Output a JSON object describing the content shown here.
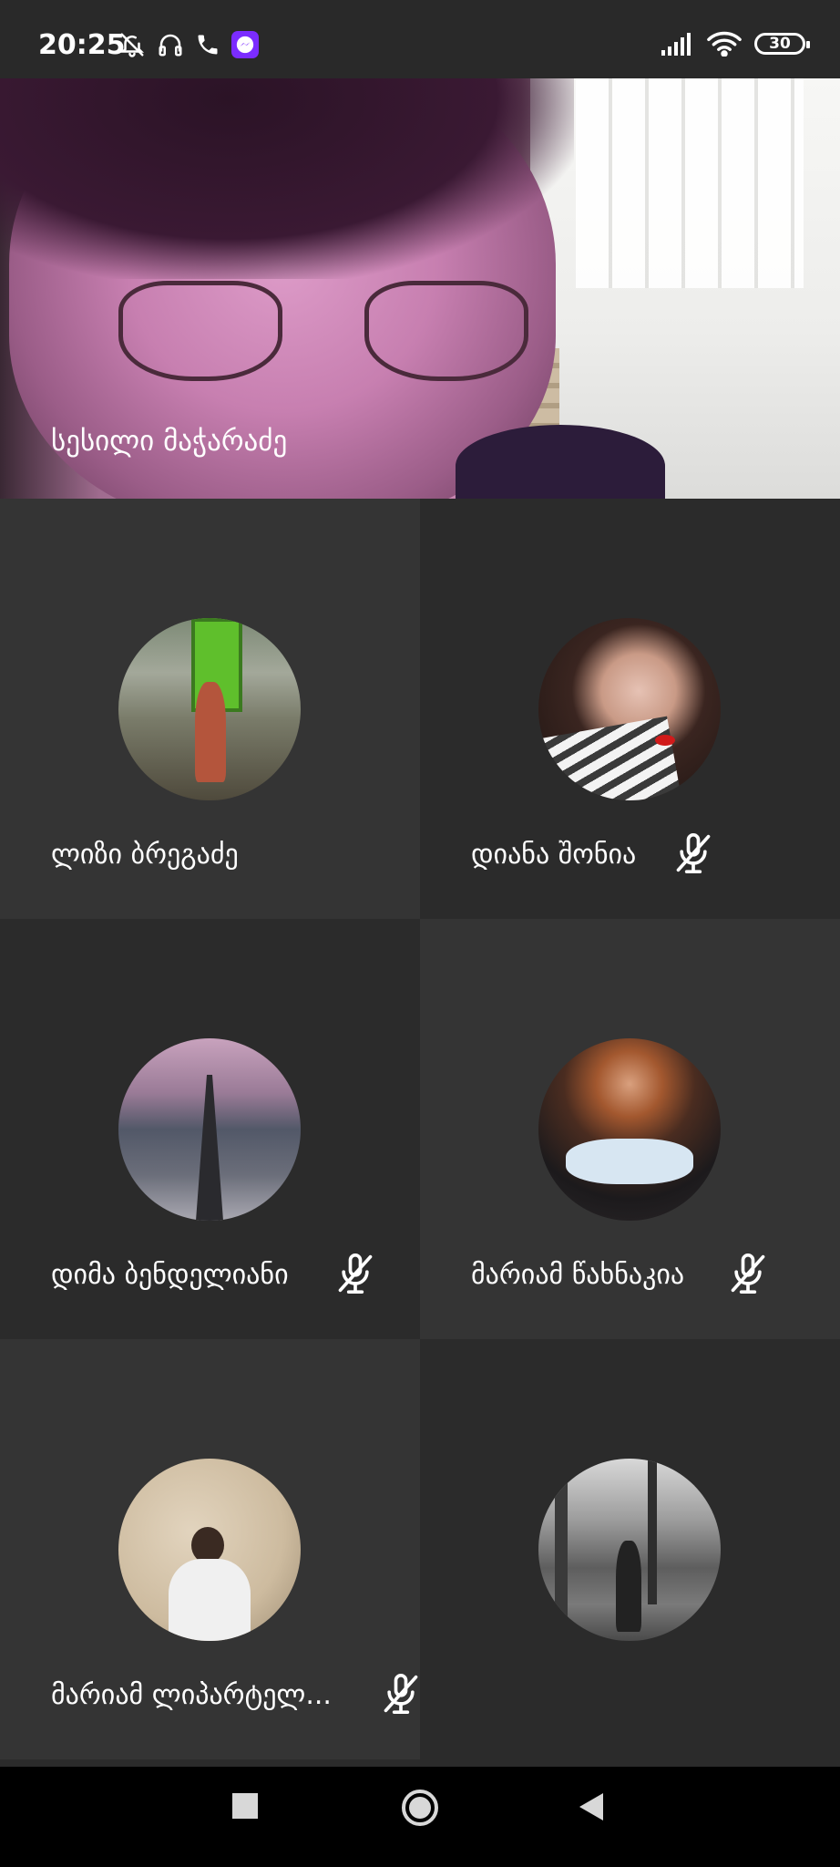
{
  "status_bar": {
    "time": "20:25",
    "left_icons": [
      "bell-off-icon",
      "headphones-icon",
      "phone-icon",
      "messenger-icon"
    ],
    "right_icons": [
      "signal-icon",
      "wifi-icon"
    ],
    "battery_level": "30"
  },
  "main_speaker": {
    "name": "სესილი მაჭარაძე"
  },
  "participants": [
    {
      "name": "ლიზი ბრეგაძე",
      "muted": false
    },
    {
      "name": "დიანა შონია",
      "muted": true
    },
    {
      "name": "დიმა ბენდელიანი",
      "muted": true
    },
    {
      "name": "მარიამ წახნაკია",
      "muted": true
    },
    {
      "name": "მარიამ ლიპარტელ...",
      "muted": true
    },
    {
      "name": "",
      "muted": false
    }
  ],
  "nav_bar": {
    "buttons": [
      "recents-square-icon",
      "home-circle-icon",
      "back-triangle-icon"
    ]
  }
}
